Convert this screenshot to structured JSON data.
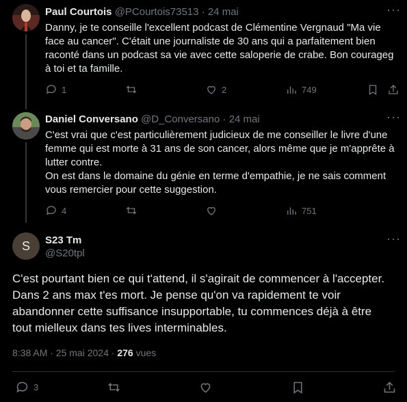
{
  "tweets": [
    {
      "name": "Paul Courtois",
      "handle": "@PCourtois73513",
      "separator": "·",
      "date": "24 mai",
      "lines": [
        "Danny, je te conseille l'excellent podcast de Clémentine Vergnaud \"Ma vie",
        "face au cancer\". C'était une journaliste de 30 ans qui a parfaitement bien",
        "raconté dans un podcast sa vie avec cette saloperie de crabe. Bon courageg",
        "à toi et ta famille."
      ],
      "replies": "1",
      "retweets": "",
      "likes": "2",
      "views": "749"
    },
    {
      "name": "Daniel Conversano",
      "handle": "@D_Conversano",
      "separator": "·",
      "date": "24 mai",
      "lines": [
        "C'est vrai que c'est particulièrement judicieux de me conseiller le livre d'une",
        "femme qui est morte à 31 ans de son cancer, alors même que je m'apprête à",
        "lutter contre.",
        "On est dans le domaine du génie en terme d'empathie, je ne sais comment",
        "vous remercier pour cette suggestion."
      ],
      "replies": "4",
      "retweets": "",
      "likes": "",
      "views": "751"
    }
  ],
  "main": {
    "avatar_letter": "S",
    "name": "S23 Tm",
    "handle": "@S20tpl",
    "lines": [
      "C'est pourtant bien ce qui t'attend, il s'agirait de commencer à l'accepter.",
      "Dans 2 ans max t'es mort. Je pense qu'on va rapidement te voir",
      "abandonner cette suffisance insupportable, tu commences déjà à être",
      "tout mielleux dans tes lives interminables."
    ],
    "time": "8:38 AM · 25 mai 2024 ·",
    "views_count": "276",
    "views_label": "vues",
    "replies": "3"
  },
  "icons": {
    "more": "more-dots-icon",
    "reply": "reply-icon",
    "retweet": "retweet-icon",
    "like": "heart-icon",
    "views": "views-chart-icon",
    "bookmark": "bookmark-icon",
    "share": "share-icon"
  },
  "colors": {
    "background": "#000000",
    "text": "#e7e9ea",
    "muted": "#71767b",
    "avatar_main": "#4a3f35"
  }
}
